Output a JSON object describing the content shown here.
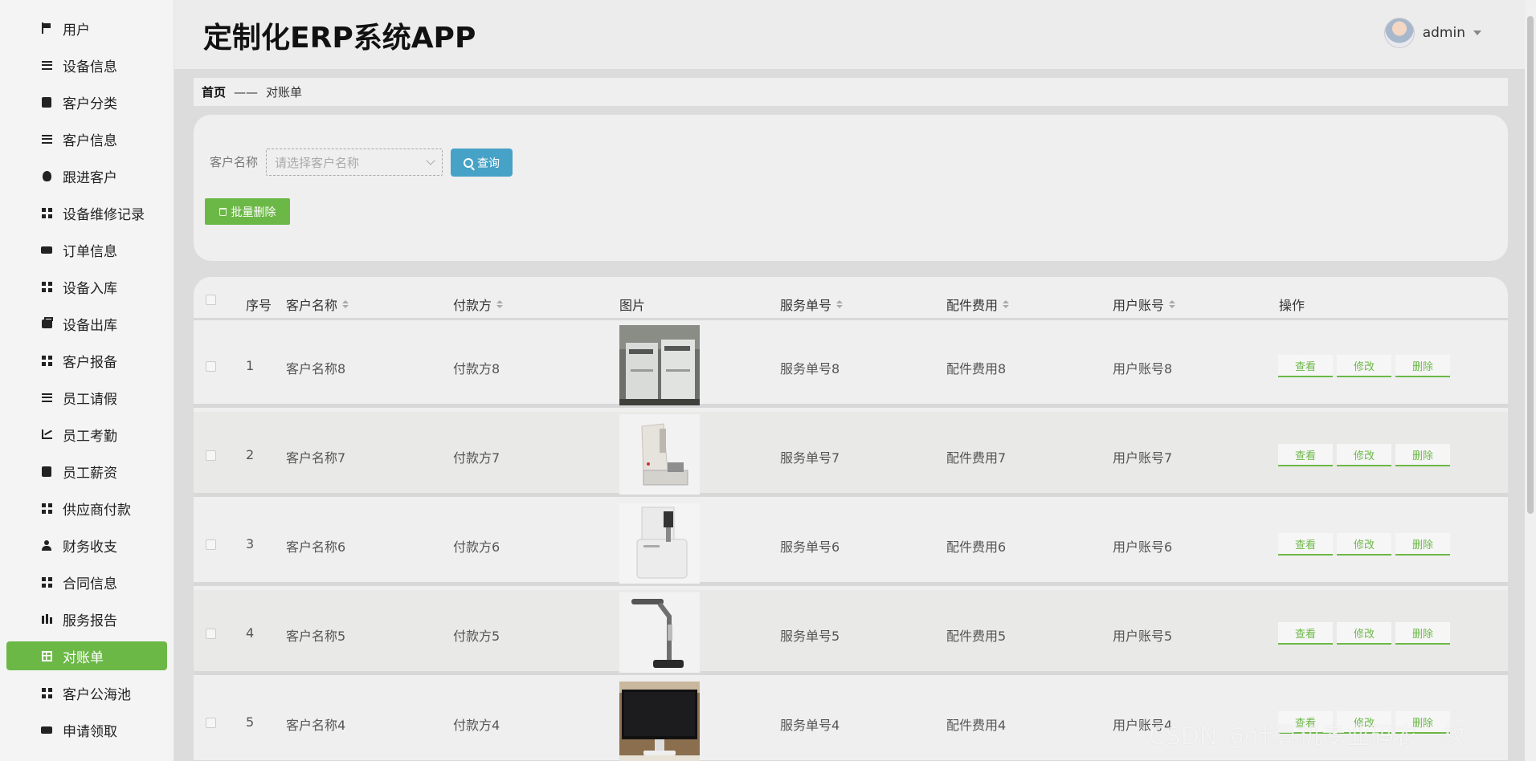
{
  "app": {
    "title": "定制化ERP系统APP"
  },
  "user": {
    "name": "admin"
  },
  "sidebar": {
    "items": [
      {
        "label": "用户",
        "icon": "flag-icon"
      },
      {
        "label": "设备信息",
        "icon": "sliders-icon"
      },
      {
        "label": "客户分类",
        "icon": "clipboard-check-icon"
      },
      {
        "label": "客户信息",
        "icon": "list-icon"
      },
      {
        "label": "跟进客户",
        "icon": "bulb-icon"
      },
      {
        "label": "设备维修记录",
        "icon": "grid-icon"
      },
      {
        "label": "订单信息",
        "icon": "ticket-icon"
      },
      {
        "label": "设备入库",
        "icon": "grid-icon"
      },
      {
        "label": "设备出库",
        "icon": "briefcase-icon"
      },
      {
        "label": "客户报备",
        "icon": "grid-icon"
      },
      {
        "label": "员工请假",
        "icon": "list-icon"
      },
      {
        "label": "员工考勤",
        "icon": "chart-icon"
      },
      {
        "label": "员工薪资",
        "icon": "clipboard-icon"
      },
      {
        "label": "供应商付款",
        "icon": "grid-icon"
      },
      {
        "label": "财务收支",
        "icon": "user-icon"
      },
      {
        "label": "合同信息",
        "icon": "grid-icon"
      },
      {
        "label": "服务报告",
        "icon": "bar-chart-icon"
      },
      {
        "label": "对账单",
        "icon": "table-icon",
        "active": true
      },
      {
        "label": "客户公海池",
        "icon": "grid-icon"
      },
      {
        "label": "申请领取",
        "icon": "ticket-icon"
      }
    ]
  },
  "breadcrumb": {
    "home": "首页",
    "separator": "——",
    "current": "对账单"
  },
  "search": {
    "label": "客户名称",
    "placeholder": "请选择客户名称",
    "query_button": "查询",
    "batch_delete_button": "批量删除"
  },
  "table": {
    "columns": [
      "序号",
      "客户名称",
      "付款方",
      "图片",
      "服务单号",
      "配件费用",
      "用户账号",
      "操作"
    ],
    "actions": {
      "view": "查看",
      "edit": "修改",
      "delete": "删除"
    },
    "rows": [
      {
        "index": "1",
        "customer": "客户名称8",
        "payer": "付款方8",
        "image": "copier-machines",
        "service_no": "服务单号8",
        "parts_fee": "配件费用8",
        "account": "用户账号8"
      },
      {
        "index": "2",
        "customer": "客户名称7",
        "payer": "付款方7",
        "image": "binding-machine",
        "service_no": "服务单号7",
        "parts_fee": "配件费用7",
        "account": "用户账号7"
      },
      {
        "index": "3",
        "customer": "客户名称6",
        "payer": "付款方6",
        "image": "punch-binder",
        "service_no": "服务单号6",
        "parts_fee": "配件费用6",
        "account": "用户账号6"
      },
      {
        "index": "4",
        "customer": "客户名称5",
        "payer": "付款方5",
        "image": "document-camera",
        "service_no": "服务单号5",
        "parts_fee": "配件费用5",
        "account": "用户账号5"
      },
      {
        "index": "5",
        "customer": "客户名称4",
        "payer": "付款方4",
        "image": "monitor",
        "service_no": "服务单号4",
        "parts_fee": "配件费用4",
        "account": "用户账号4"
      }
    ]
  },
  "watermark": "CSDN @计算机专业码农一枚",
  "colors": {
    "accent_green": "#6cb847",
    "query_blue": "#47a2c7"
  }
}
